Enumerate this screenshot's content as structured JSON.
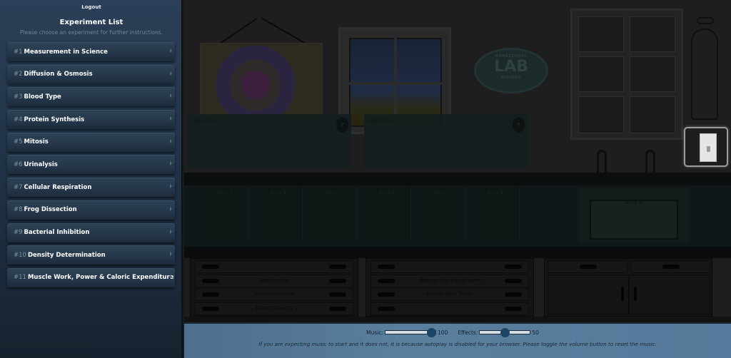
{
  "sidebar": {
    "logout_label": "Logout",
    "title": "Experiment List",
    "subtitle": "Please choose an experiment for further instructions.",
    "experiments": [
      {
        "num": "#1",
        "name": "Measurement in Science"
      },
      {
        "num": "#2",
        "name": "Diffusion & Osmosis"
      },
      {
        "num": "#3",
        "name": "Blood Type"
      },
      {
        "num": "#4",
        "name": "Protein Synthesis"
      },
      {
        "num": "#5",
        "name": "Mitosis"
      },
      {
        "num": "#6",
        "name": "Urinalysis"
      },
      {
        "num": "#7",
        "name": "Cellular Respiration"
      },
      {
        "num": "#8",
        "name": "Frog Dissection"
      },
      {
        "num": "#9",
        "name": "Bacterial Inhibition"
      },
      {
        "num": "#10",
        "name": "Density Determination"
      },
      {
        "num": "#11",
        "name": "Muscle Work, Power & Caloric Expenditure"
      }
    ]
  },
  "lab": {
    "sign": {
      "top": "HOMESCHOOL",
      "main": "LAB",
      "bottom": "BIOLOGY"
    },
    "lab_areas": [
      {
        "label": "Lab Area 1",
        "help": "?"
      },
      {
        "label": "Lab Area 2",
        "help": "?"
      }
    ],
    "counter_areas": [
      "Area 3",
      "Area 4",
      "Area 5",
      "Area 6",
      "Area 7",
      "Area 8"
    ],
    "sink_area": "Area 9",
    "drawers_left": [
      "",
      "Specimens",
      "Miscellaneous",
      "Basic Objects"
    ],
    "drawers_right": [
      "",
      "Measuring Equipment",
      "Dissection Tools",
      ""
    ],
    "drawer_chevron": "⌄"
  },
  "audio": {
    "music_label": "Music:",
    "music_value": 100,
    "effects_label": "Effects:",
    "effects_value": 50,
    "note": "If you are expecting music to start and it does not, it is because autoplay is disabled for your browser. Please toggle the volume button to reset the music."
  }
}
